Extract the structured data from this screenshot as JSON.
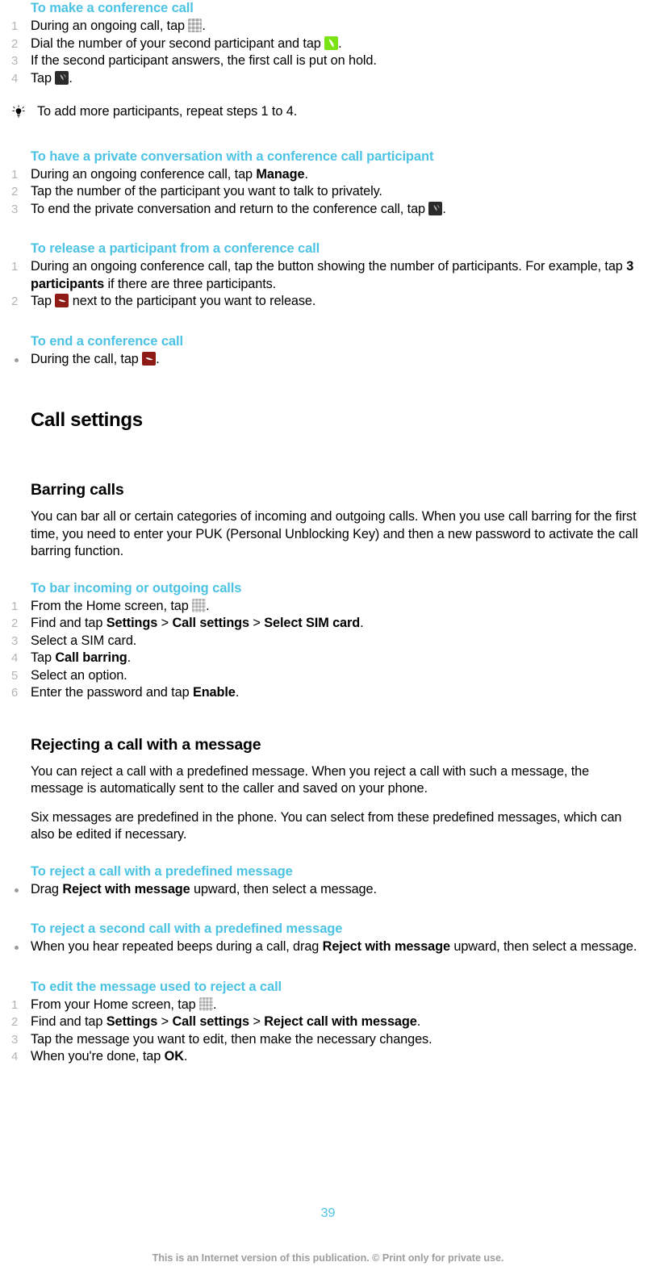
{
  "document": {
    "page_number": "39",
    "footer_note": "This is an Internet version of this publication. © Print only for private use.",
    "accent_color": "#4cc3e4"
  },
  "icons": {
    "dialpad": "dialpad-icon",
    "call": "green-call-icon",
    "merge": "merge-calls-icon",
    "endcall": "end-call-icon",
    "appdrawer": "app-drawer-icon",
    "tip": "lightbulb-tip-icon"
  },
  "sections": {
    "make_conference": {
      "heading": "To make a conference call",
      "steps": [
        {
          "pre": "During an ongoing call, tap ",
          "icon": "dialpad",
          "post": "."
        },
        {
          "pre": "Dial the number of your second participant and tap ",
          "icon": "call",
          "post": "."
        },
        {
          "pre": "If the second participant answers, the first call is put on hold.",
          "icon": "",
          "post": ""
        },
        {
          "pre": "Tap ",
          "icon": "merge",
          "post": "."
        }
      ],
      "tip": "To add more participants, repeat steps 1 to 4."
    },
    "private_conversation": {
      "heading": "To have a private conversation with a conference call participant",
      "steps": [
        {
          "pre": "During an ongoing conference call, tap ",
          "bold": "Manage",
          "icon": "",
          "post": "."
        },
        {
          "pre": "Tap the number of the participant you want to talk to privately.",
          "bold": "",
          "icon": "",
          "post": ""
        },
        {
          "pre": "To end the private conversation and return to the conference call, tap ",
          "bold": "",
          "icon": "merge",
          "post": "."
        }
      ]
    },
    "release_participant": {
      "heading": "To release a participant from a conference call",
      "steps": [
        {
          "pre": "During an ongoing conference call, tap the button showing the number of participants. For example, tap ",
          "bold": "3 participants",
          "icon": "",
          "post": " if there are three participants."
        },
        {
          "pre": "Tap ",
          "bold": "",
          "icon": "endcall",
          "post": " next to the participant you want to release."
        }
      ]
    },
    "end_conference": {
      "heading": "To end a conference call",
      "bullets": [
        {
          "pre": "During the call, tap ",
          "icon": "endcall",
          "post": "."
        }
      ]
    },
    "call_settings": {
      "heading": "Call settings"
    },
    "barring_calls": {
      "heading": "Barring calls",
      "paragraph": "You can bar all or certain categories of incoming and outgoing calls. When you use call barring for the first time, you need to enter your PUK (Personal Unblocking Key) and then a new password to activate the call barring function."
    },
    "bar_calls_proc": {
      "heading": "To bar incoming or outgoing calls",
      "steps": [
        {
          "pre": "From the Home screen, tap ",
          "icon": "appdrawer",
          "post": "."
        },
        {
          "pre": "Find and tap ",
          "bold": "Settings",
          "mid": " > ",
          "bold2": "Call settings",
          "mid2": " > ",
          "bold3": "Select SIM card",
          "post": "."
        },
        {
          "pre": "Select a SIM card.",
          "post": ""
        },
        {
          "pre": "Tap ",
          "bold": "Call barring",
          "post": "."
        },
        {
          "pre": "Select an option.",
          "post": ""
        },
        {
          "pre": "Enter the password and tap ",
          "bold": "Enable",
          "post": "."
        }
      ]
    },
    "rejecting_message": {
      "heading": "Rejecting a call with a message",
      "paragraph_1": "You can reject a call with a predefined message. When you reject a call with such a message, the message is automatically sent to the caller and saved on your phone.",
      "paragraph_2": "Six messages are predefined in the phone. You can select from these predefined messages, which can also be edited if necessary."
    },
    "reject_predefined": {
      "heading": "To reject a call with a predefined message",
      "bullets": [
        {
          "pre": "Drag ",
          "bold": "Reject with message",
          "post": " upward, then select a message."
        }
      ]
    },
    "reject_second": {
      "heading": "To reject a second call with a predefined message",
      "bullets": [
        {
          "pre": "When you hear repeated beeps during a call, drag ",
          "bold": "Reject with message",
          "post": " upward, then select a message."
        }
      ]
    },
    "edit_reject_message": {
      "heading": "To edit the message used to reject a call",
      "steps": [
        {
          "pre": "From your Home screen, tap ",
          "icon": "appdrawer",
          "post": "."
        },
        {
          "pre": "Find and tap ",
          "bold": "Settings",
          "mid": " > ",
          "bold2": "Call settings",
          "mid2": " > ",
          "bold3": "Reject call with message",
          "post": "."
        },
        {
          "pre": "Tap the message you want to edit, then make the necessary changes.",
          "post": ""
        },
        {
          "pre": "When you're done, tap ",
          "bold": "OK",
          "post": "."
        }
      ]
    }
  }
}
